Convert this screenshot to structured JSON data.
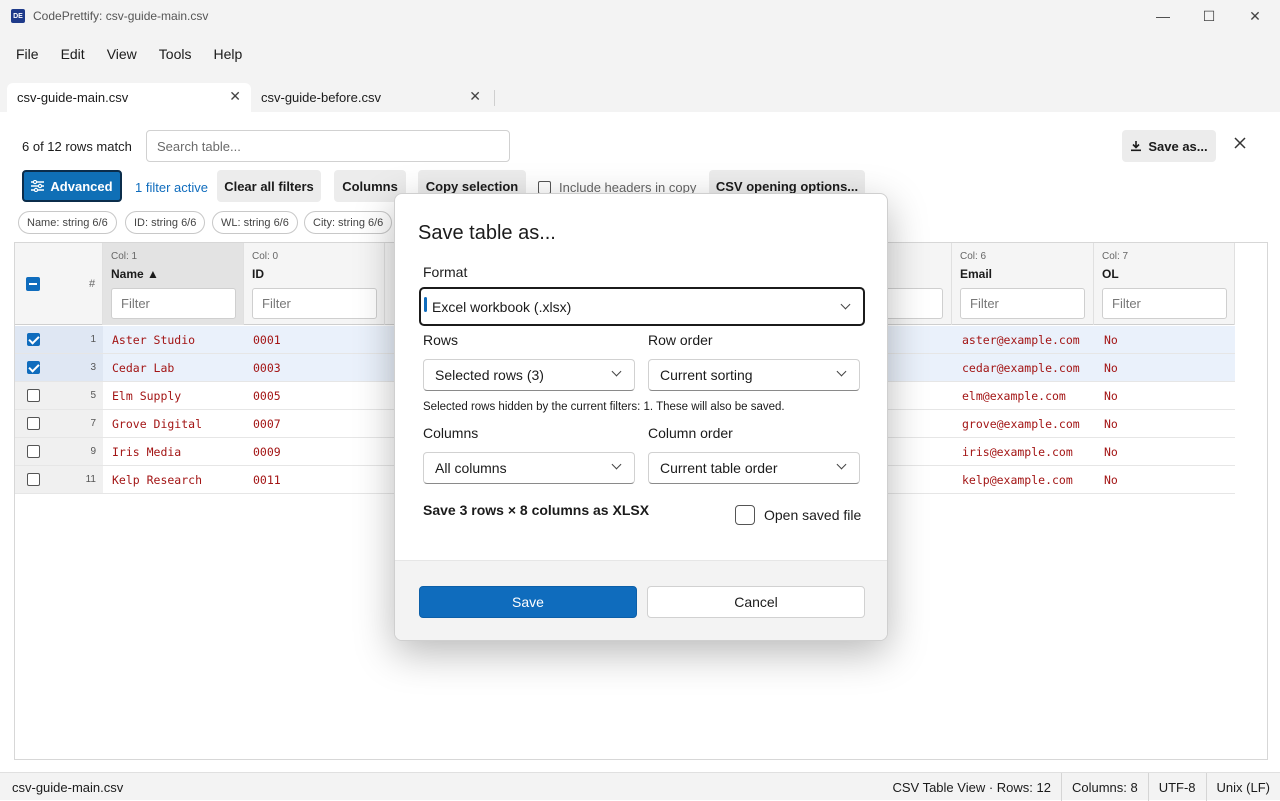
{
  "window": {
    "app_icon_text": "DE",
    "title": "CodePrettify: csv-guide-main.csv",
    "minimize_glyph": "—",
    "maximize_glyph": "☐",
    "close_glyph": "✕"
  },
  "menu": [
    "File",
    "Edit",
    "View",
    "Tools",
    "Help"
  ],
  "tabs": [
    {
      "label": "csv-guide-main.csv",
      "active": true
    },
    {
      "label": "csv-guide-before.csv",
      "active": false
    }
  ],
  "tab_close_glyph": "✕",
  "toolbar": {
    "match_text": "6 of 12 rows match",
    "search_placeholder": "Search table...",
    "save_as_label": "Save as...",
    "advanced_label": "Advanced",
    "filter_active": "1 filter active",
    "clear_filters": "Clear all filters",
    "columns": "Columns",
    "copy_selection": "Copy selection",
    "include_headers": "Include headers in copy",
    "csv_options": "CSV opening options..."
  },
  "chips": [
    "Name: string 6/6",
    "ID: string 6/6",
    "WL: string 6/6",
    "City: string 6/6"
  ],
  "table": {
    "hash": "#",
    "filter_placeholder": "Filter",
    "columns": [
      {
        "colno": "Col: 1",
        "name": "Name ▲"
      },
      {
        "colno": "Col: 0",
        "name": "ID"
      },
      {
        "colno": "Col: 6",
        "name": "Email"
      },
      {
        "colno": "Col: 7",
        "name": "OL"
      }
    ],
    "rows": [
      {
        "num": "1",
        "checked": true,
        "name": "Aster Studio",
        "id": "0001",
        "email": "aster@example.com",
        "ol": "No"
      },
      {
        "num": "3",
        "checked": true,
        "name": "Cedar Lab",
        "id": "0003",
        "email": "cedar@example.com",
        "ol": "No"
      },
      {
        "num": "5",
        "checked": false,
        "name": "Elm Supply",
        "id": "0005",
        "email": "elm@example.com",
        "ol": "No"
      },
      {
        "num": "7",
        "checked": false,
        "name": "Grove Digital",
        "id": "0007",
        "email": "grove@example.com",
        "ol": "No"
      },
      {
        "num": "9",
        "checked": false,
        "name": "Iris Media",
        "id": "0009",
        "email": "iris@example.com",
        "ol": "No"
      },
      {
        "num": "11",
        "checked": false,
        "name": "Kelp Research",
        "id": "0011",
        "email": "kelp@example.com",
        "ol": "No"
      }
    ]
  },
  "status": {
    "file": "csv-guide-main.csv",
    "view": "CSV Table View · Rows: 12",
    "columns": "Columns: 8",
    "encoding": "UTF-8",
    "line_ending": "Unix (LF)"
  },
  "dialog": {
    "title": "Save table as...",
    "format_label": "Format",
    "format_value": "Excel workbook (.xlsx)",
    "rows_label": "Rows",
    "rows_value": "Selected rows (3)",
    "row_order_label": "Row order",
    "row_order_value": "Current sorting",
    "note": "Selected rows hidden by the current filters: 1. These will also be saved.",
    "columns_label": "Columns",
    "columns_value": "All columns",
    "column_order_label": "Column order",
    "column_order_value": "Current table order",
    "summary": "Save 3 rows × 8 columns as XLSX",
    "open_saved_label": "Open saved file",
    "save_button": "Save",
    "cancel_button": "Cancel"
  },
  "colors": {
    "accent": "#0f6cbd",
    "cell_text": "#a31515"
  }
}
